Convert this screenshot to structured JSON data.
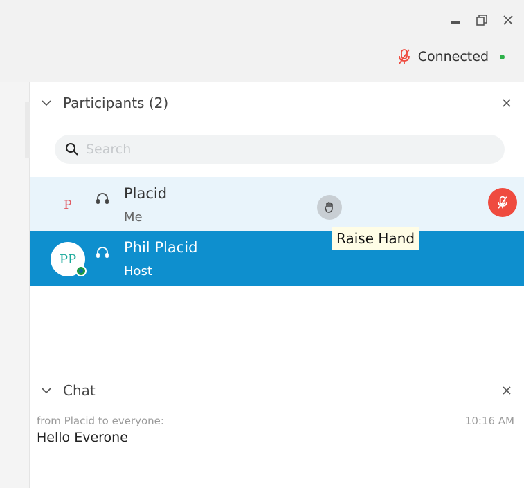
{
  "window": {
    "minimize_icon": "minimize-icon",
    "restore_icon": "restore-icon",
    "close_icon": "close-icon"
  },
  "status": {
    "label": "Connected",
    "mic_icon": "mic-muted-icon",
    "dot_color": "#2eb14a"
  },
  "participants": {
    "title": "Participants (2)",
    "search_placeholder": "Search",
    "items": [
      {
        "initials": "P",
        "name": "Placid",
        "role": "Me",
        "muted": true
      },
      {
        "initials": "PP",
        "name": "Phil Placid",
        "role": "Host",
        "selected": true
      }
    ],
    "raise_hand_tooltip": "Raise Hand"
  },
  "chat": {
    "title": "Chat",
    "messages": [
      {
        "from": "from Placid to everyone:",
        "time": "10:16 AM",
        "text": "Hello Everone"
      }
    ]
  },
  "colors": {
    "accent": "#0e8fce",
    "mute_red": "#ef4b3f",
    "row_highlight": "#e9f4fb"
  }
}
